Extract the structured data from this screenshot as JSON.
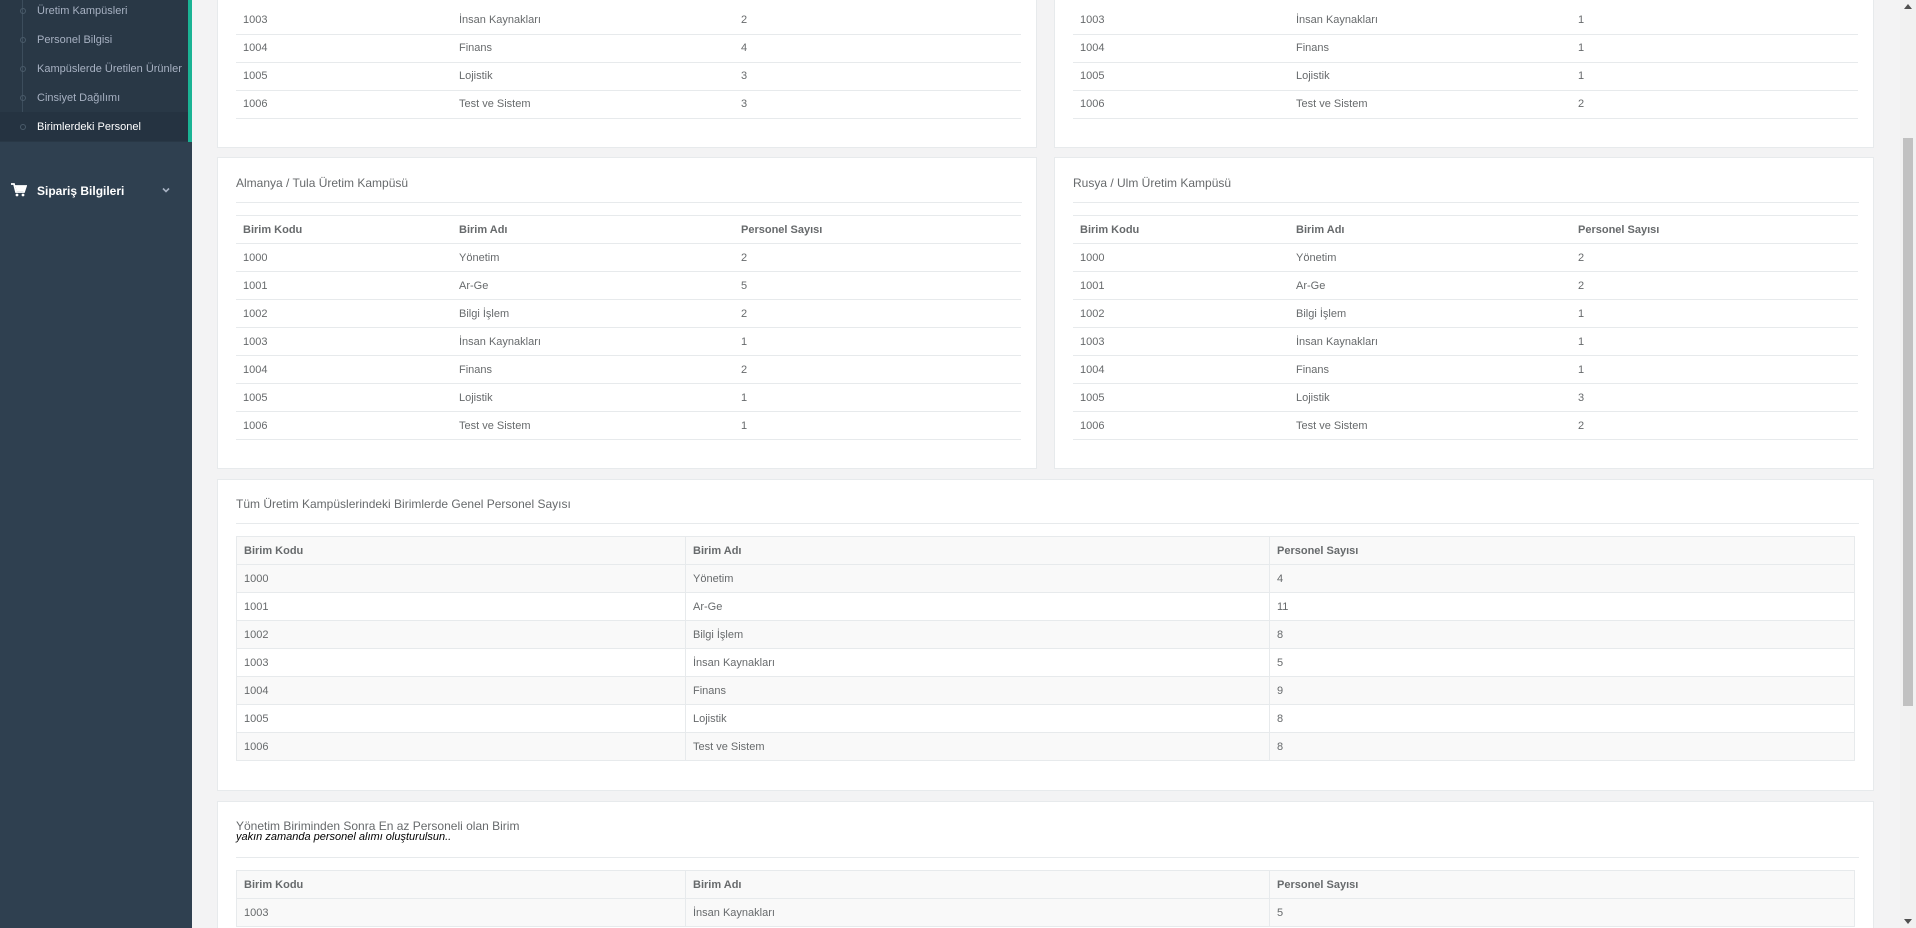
{
  "sidebar": {
    "sub_items": [
      {
        "label": "Üretim Kampüsleri"
      },
      {
        "label": "Personel Bilgisi"
      },
      {
        "label": "Kampüslerde Üretilen Ürünler"
      },
      {
        "label": "Cinsiyet Dağılımı"
      },
      {
        "label": "Birimlerdeki Personel"
      }
    ],
    "order_menu": {
      "label": "Sipariş Bilgileri",
      "icon": "cart-icon"
    }
  },
  "tables": {
    "headers": {
      "code": "Birim Kodu",
      "name": "Birim Adı",
      "count": "Personel Sayısı"
    },
    "top_left": {
      "rows": [
        {
          "code": "1003",
          "name": "İnsan Kaynakları",
          "count": "2"
        },
        {
          "code": "1004",
          "name": "Finans",
          "count": "4"
        },
        {
          "code": "1005",
          "name": "Lojistik",
          "count": "3"
        },
        {
          "code": "1006",
          "name": "Test ve Sistem",
          "count": "3"
        }
      ]
    },
    "top_right": {
      "rows": [
        {
          "code": "1003",
          "name": "İnsan Kaynakları",
          "count": "1"
        },
        {
          "code": "1004",
          "name": "Finans",
          "count": "1"
        },
        {
          "code": "1005",
          "name": "Lojistik",
          "count": "1"
        },
        {
          "code": "1006",
          "name": "Test ve Sistem",
          "count": "2"
        }
      ]
    },
    "germany": {
      "title": "Almanya / Tula Üretim Kampüsü",
      "rows": [
        {
          "code": "1000",
          "name": "Yönetim",
          "count": "2"
        },
        {
          "code": "1001",
          "name": "Ar-Ge",
          "count": "5"
        },
        {
          "code": "1002",
          "name": "Bilgi İşlem",
          "count": "2"
        },
        {
          "code": "1003",
          "name": "İnsan Kaynakları",
          "count": "1"
        },
        {
          "code": "1004",
          "name": "Finans",
          "count": "2"
        },
        {
          "code": "1005",
          "name": "Lojistik",
          "count": "1"
        },
        {
          "code": "1006",
          "name": "Test ve Sistem",
          "count": "1"
        }
      ]
    },
    "russia": {
      "title": "Rusya / Ulm Üretim Kampüsü",
      "rows": [
        {
          "code": "1000",
          "name": "Yönetim",
          "count": "2"
        },
        {
          "code": "1001",
          "name": "Ar-Ge",
          "count": "2"
        },
        {
          "code": "1002",
          "name": "Bilgi İşlem",
          "count": "1"
        },
        {
          "code": "1003",
          "name": "İnsan Kaynakları",
          "count": "1"
        },
        {
          "code": "1004",
          "name": "Finans",
          "count": "1"
        },
        {
          "code": "1005",
          "name": "Lojistik",
          "count": "3"
        },
        {
          "code": "1006",
          "name": "Test ve Sistem",
          "count": "2"
        }
      ]
    },
    "all": {
      "title": "Tüm Üretim Kampüslerindeki Birimlerde Genel Personel Sayısı",
      "rows": [
        {
          "code": "1000",
          "name": "Yönetim",
          "count": "4"
        },
        {
          "code": "1001",
          "name": "Ar-Ge",
          "count": "11"
        },
        {
          "code": "1002",
          "name": "Bilgi İşlem",
          "count": "8"
        },
        {
          "code": "1003",
          "name": "İnsan Kaynakları",
          "count": "5"
        },
        {
          "code": "1004",
          "name": "Finans",
          "count": "9"
        },
        {
          "code": "1005",
          "name": "Lojistik",
          "count": "8"
        },
        {
          "code": "1006",
          "name": "Test ve Sistem",
          "count": "8"
        }
      ]
    },
    "least": {
      "title": "Yönetim Biriminden Sonra En az Personeli olan Birim",
      "subtitle": "yakın zamanda personel alımı oluşturulsun..",
      "rows": [
        {
          "code": "1003",
          "name": "İnsan Kaynakları",
          "count": "5"
        }
      ]
    }
  }
}
